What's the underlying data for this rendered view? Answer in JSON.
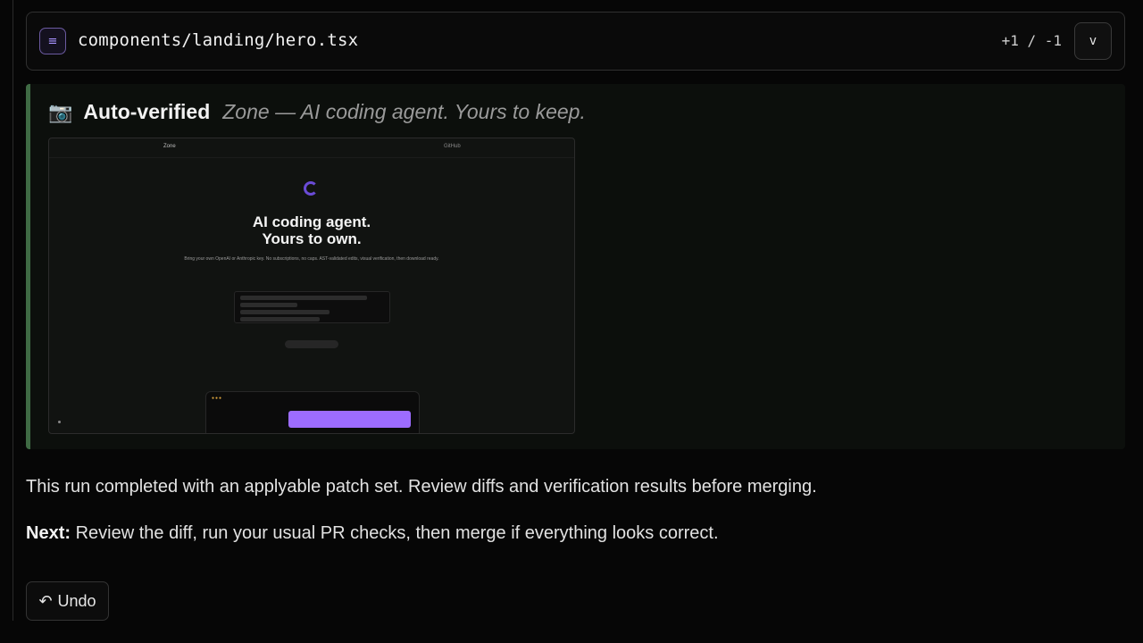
{
  "file": {
    "path": "components/landing/hero.tsx",
    "icon": "file-lines-icon",
    "diff_stats": "+1 / -1",
    "toggle_label": "v"
  },
  "verification": {
    "icon": "camera-icon",
    "title": "Auto-verified",
    "subtitle": "Zone — AI coding agent. Yours to keep.",
    "accent_color": "#3f6a44",
    "screenshot": {
      "brand": "Zone",
      "github_label": "GitHub",
      "hero_line_1": "AI coding agent.",
      "hero_line_2": "Yours to own.",
      "description": "Bring your own OpenAI or Anthropic key. No subscriptions, no caps. AST-validated edits, visual verification, then download ready."
    }
  },
  "summary": "This run completed with an applyable patch set. Review diffs and verification results before merging.",
  "next": {
    "label": "Next:",
    "text": " Review the diff, run your usual PR checks, then merge if everything looks correct."
  },
  "undo": {
    "icon": "undo-icon",
    "label": "Undo"
  }
}
